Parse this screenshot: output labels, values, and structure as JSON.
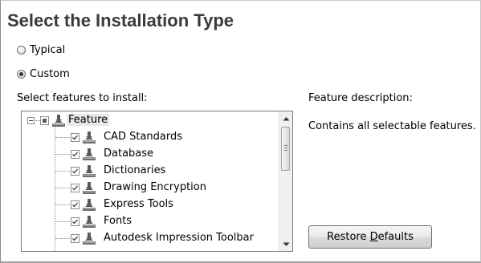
{
  "header": {
    "title": "Select the Installation Type"
  },
  "install_type": {
    "options": [
      {
        "label": "Typical",
        "selected": false
      },
      {
        "label": "Custom",
        "selected": true
      }
    ]
  },
  "features": {
    "label": "Select features to install:",
    "root": {
      "label": "Feature",
      "state": "partial",
      "expanded": true,
      "icon": "install-feature-icon"
    },
    "items": [
      {
        "label": "CAD Standards",
        "checked": true,
        "icon": "install-feature-icon"
      },
      {
        "label": "Database",
        "checked": true,
        "icon": "install-feature-icon"
      },
      {
        "label": "Dictionaries",
        "checked": true,
        "icon": "install-feature-icon"
      },
      {
        "label": "Drawing Encryption",
        "checked": true,
        "icon": "install-feature-icon"
      },
      {
        "label": "Express Tools",
        "checked": true,
        "icon": "install-feature-icon"
      },
      {
        "label": "Fonts",
        "checked": true,
        "icon": "install-feature-icon"
      },
      {
        "label": "Autodesk Impression Toolbar",
        "checked": true,
        "icon": "install-feature-icon"
      }
    ]
  },
  "description": {
    "label": "Feature description:",
    "text": "Contains all selectable features."
  },
  "restore_button": {
    "label_before": "Restore ",
    "label_accel": "D",
    "label_after": "efaults"
  }
}
